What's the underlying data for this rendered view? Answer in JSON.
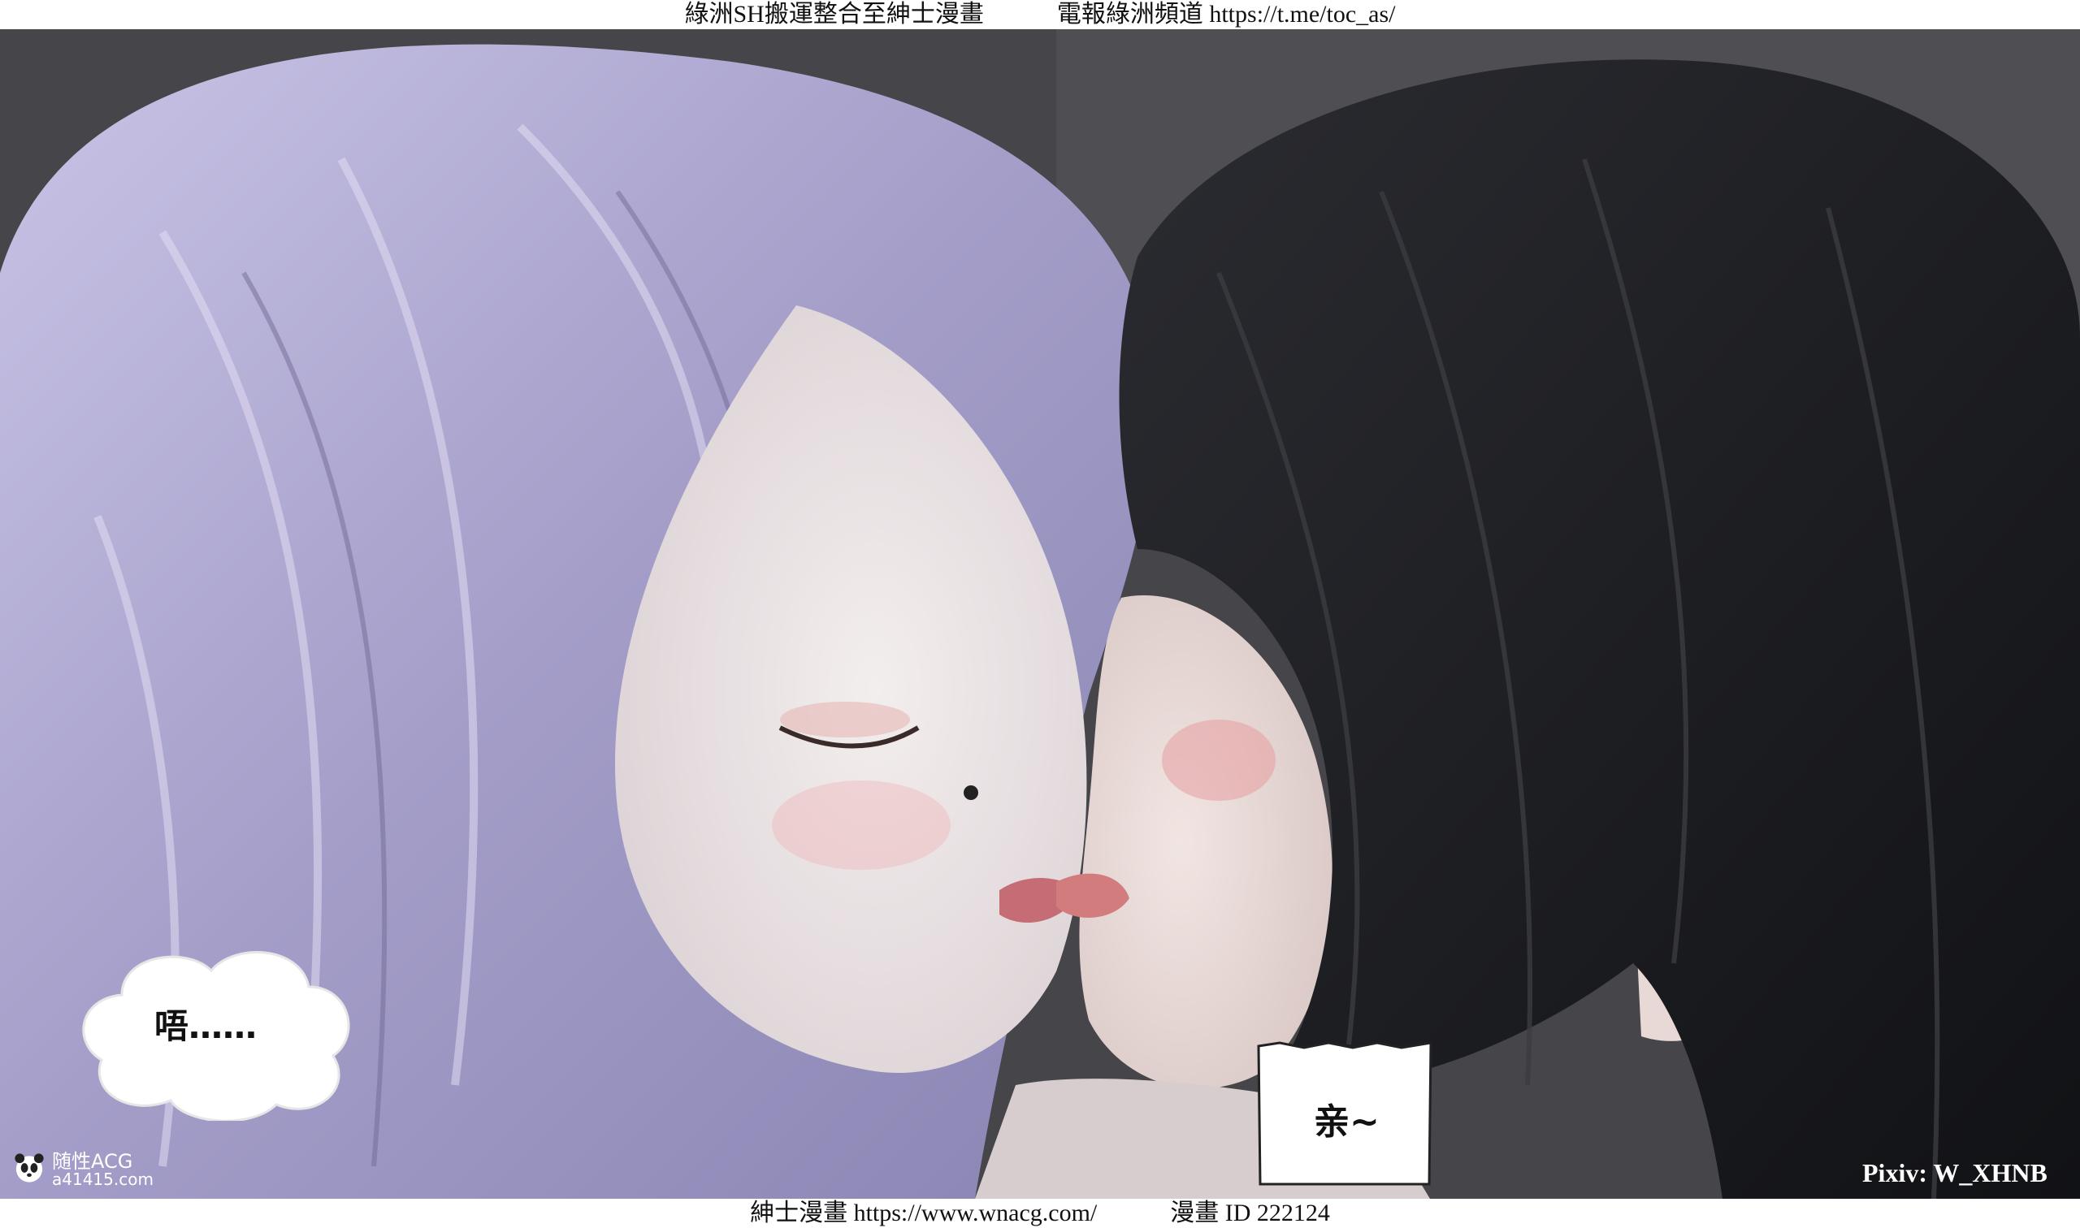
{
  "header": {
    "text": "綠洲SH搬運整合至紳士漫畫　　　電報綠洲頻道 https://t.me/toc_as/"
  },
  "footer": {
    "text": "紳士漫畫 https://www.wnacg.com/　　　漫畫 ID 222124"
  },
  "speech_bubbles": {
    "left_cloud": "唔……",
    "right_box": "亲~"
  },
  "watermark": {
    "logo_name": "随性ACG",
    "logo_domain": "a41415.com",
    "logo_icon": "panda-icon"
  },
  "credit": "Pixiv: W_XHNB",
  "colors": {
    "lavender_hair": "#a9a3cc",
    "black_hair": "#1a1b1f",
    "skin": "#ece6e6",
    "background": "#46464b"
  }
}
